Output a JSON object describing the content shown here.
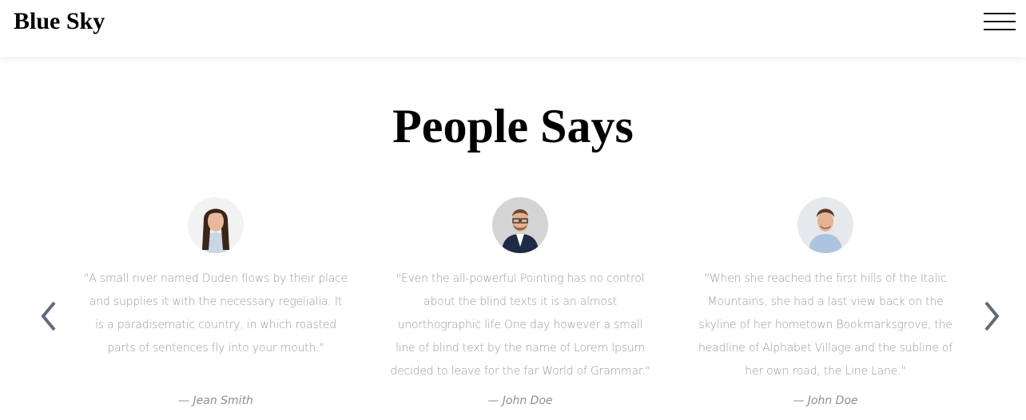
{
  "header": {
    "brand": "Blue Sky",
    "menu_icon": "hamburger-menu-icon"
  },
  "testimonials": {
    "title": "People Says",
    "prev_icon": "chevron-left-icon",
    "next_icon": "chevron-right-icon",
    "items": [
      {
        "quote": "\"A small river named Duden flows by their place and supplies it with the necessary regelialia. It is a paradisematic country, in which roasted parts of sentences fly into your mouth.\"",
        "author": "— Jean Smith",
        "avatar": "woman-portrait"
      },
      {
        "quote": "\"Even the all-powerful Pointing has no control about the blind texts it is an almost unorthographic life One day however a small line of blind text by the name of Lorem Ipsum decided to leave for the far World of Grammar.\"",
        "author": "— John Doe",
        "avatar": "man-with-glasses-portrait"
      },
      {
        "quote": "\"When she reached the first hills of the Italic Mountains, she had a last view back on the skyline of her hometown Bookmarksgrove, the headline of Alphabet Village and the subline of her own road, the Line Lane.\"",
        "author": "— John Doe",
        "avatar": "smiling-man-portrait"
      }
    ]
  },
  "colors": {
    "text_muted": "#9a9a9a",
    "arrow": "#5f6b78",
    "heading": "#000000"
  }
}
